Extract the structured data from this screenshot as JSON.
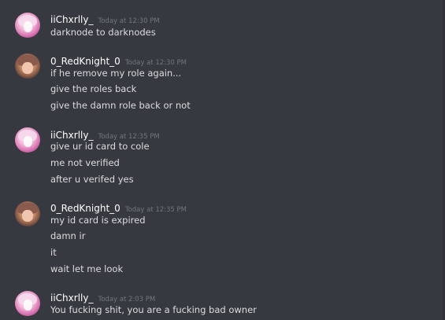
{
  "colors": {
    "background": "#36393f",
    "username": "#ffffff",
    "message_text": "#dcddde",
    "timestamp": "#72767d"
  },
  "groups": [
    {
      "username": "iiChxrlly_",
      "timestamp": "Today at 12:30 PM",
      "avatar": "pink-anime-avatar",
      "messages": [
        "darknode to darknodes"
      ]
    },
    {
      "username": "0_RedKnight_0",
      "timestamp": "Today at 12:30 PM",
      "avatar": "brown-anime-avatar",
      "messages": [
        "if he remove my role again...",
        "give the roles back",
        "give the damn role back or not"
      ]
    },
    {
      "username": "iiChxrlly_",
      "timestamp": "Today at 12:35 PM",
      "avatar": "pink-anime-avatar",
      "messages": [
        "give ur id card to cole",
        "me not verified",
        "after u verifed yes"
      ]
    },
    {
      "username": "0_RedKnight_0",
      "timestamp": "Today at 12:35 PM",
      "avatar": "brown-anime-avatar",
      "messages": [
        "my id card is expired",
        "damn ir",
        "it",
        "wait let me look"
      ]
    },
    {
      "username": "iiChxrlly_",
      "timestamp": "Today at 2:03 PM",
      "avatar": "pink-anime-avatar",
      "messages": [
        "You fucking shit, you are a fucking bad owner"
      ]
    }
  ]
}
